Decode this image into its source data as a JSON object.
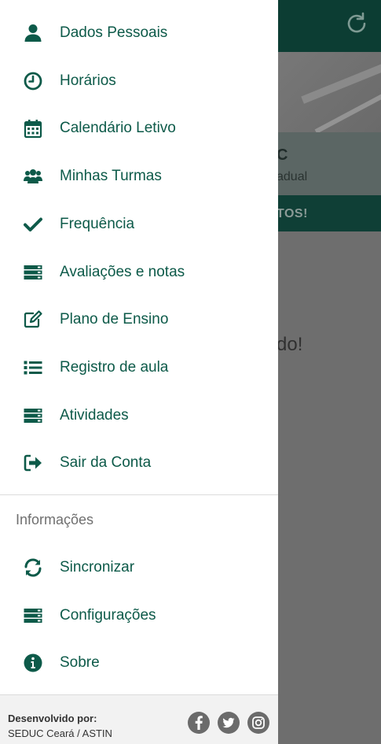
{
  "background": {
    "card_title": "C",
    "card_subtitle": "adual",
    "notice": "TOS!",
    "body_text": "do!"
  },
  "menu": {
    "items": [
      {
        "label": "Dados Pessoais",
        "icon": "user-icon"
      },
      {
        "label": "Horários",
        "icon": "clock-icon"
      },
      {
        "label": "Calendário Letivo",
        "icon": "calendar-icon"
      },
      {
        "label": "Minhas Turmas",
        "icon": "users-icon"
      },
      {
        "label": "Frequência",
        "icon": "check-icon"
      },
      {
        "label": "Avaliações e notas",
        "icon": "list-bars-icon"
      },
      {
        "label": "Plano de Ensino",
        "icon": "edit-icon"
      },
      {
        "label": "Registro de aula",
        "icon": "list-icon"
      },
      {
        "label": "Atividades",
        "icon": "list-bars-icon"
      },
      {
        "label": "Sair da Conta",
        "icon": "sign-out-icon"
      }
    ],
    "section_title": "Informações",
    "info_items": [
      {
        "label": "Sincronizar",
        "icon": "sync-icon"
      },
      {
        "label": "Configurações",
        "icon": "list-bars-icon"
      },
      {
        "label": "Sobre",
        "icon": "info-icon"
      }
    ]
  },
  "footer": {
    "developed_by_label": "Desenvolvido por:",
    "developer": "SEDUC Ceará / ASTIN",
    "social": [
      "facebook-icon",
      "twitter-icon",
      "instagram-icon"
    ]
  },
  "colors": {
    "accent": "#0d5a49",
    "toolbar": "#0c3d33",
    "overlay": "#6e6e6e"
  }
}
